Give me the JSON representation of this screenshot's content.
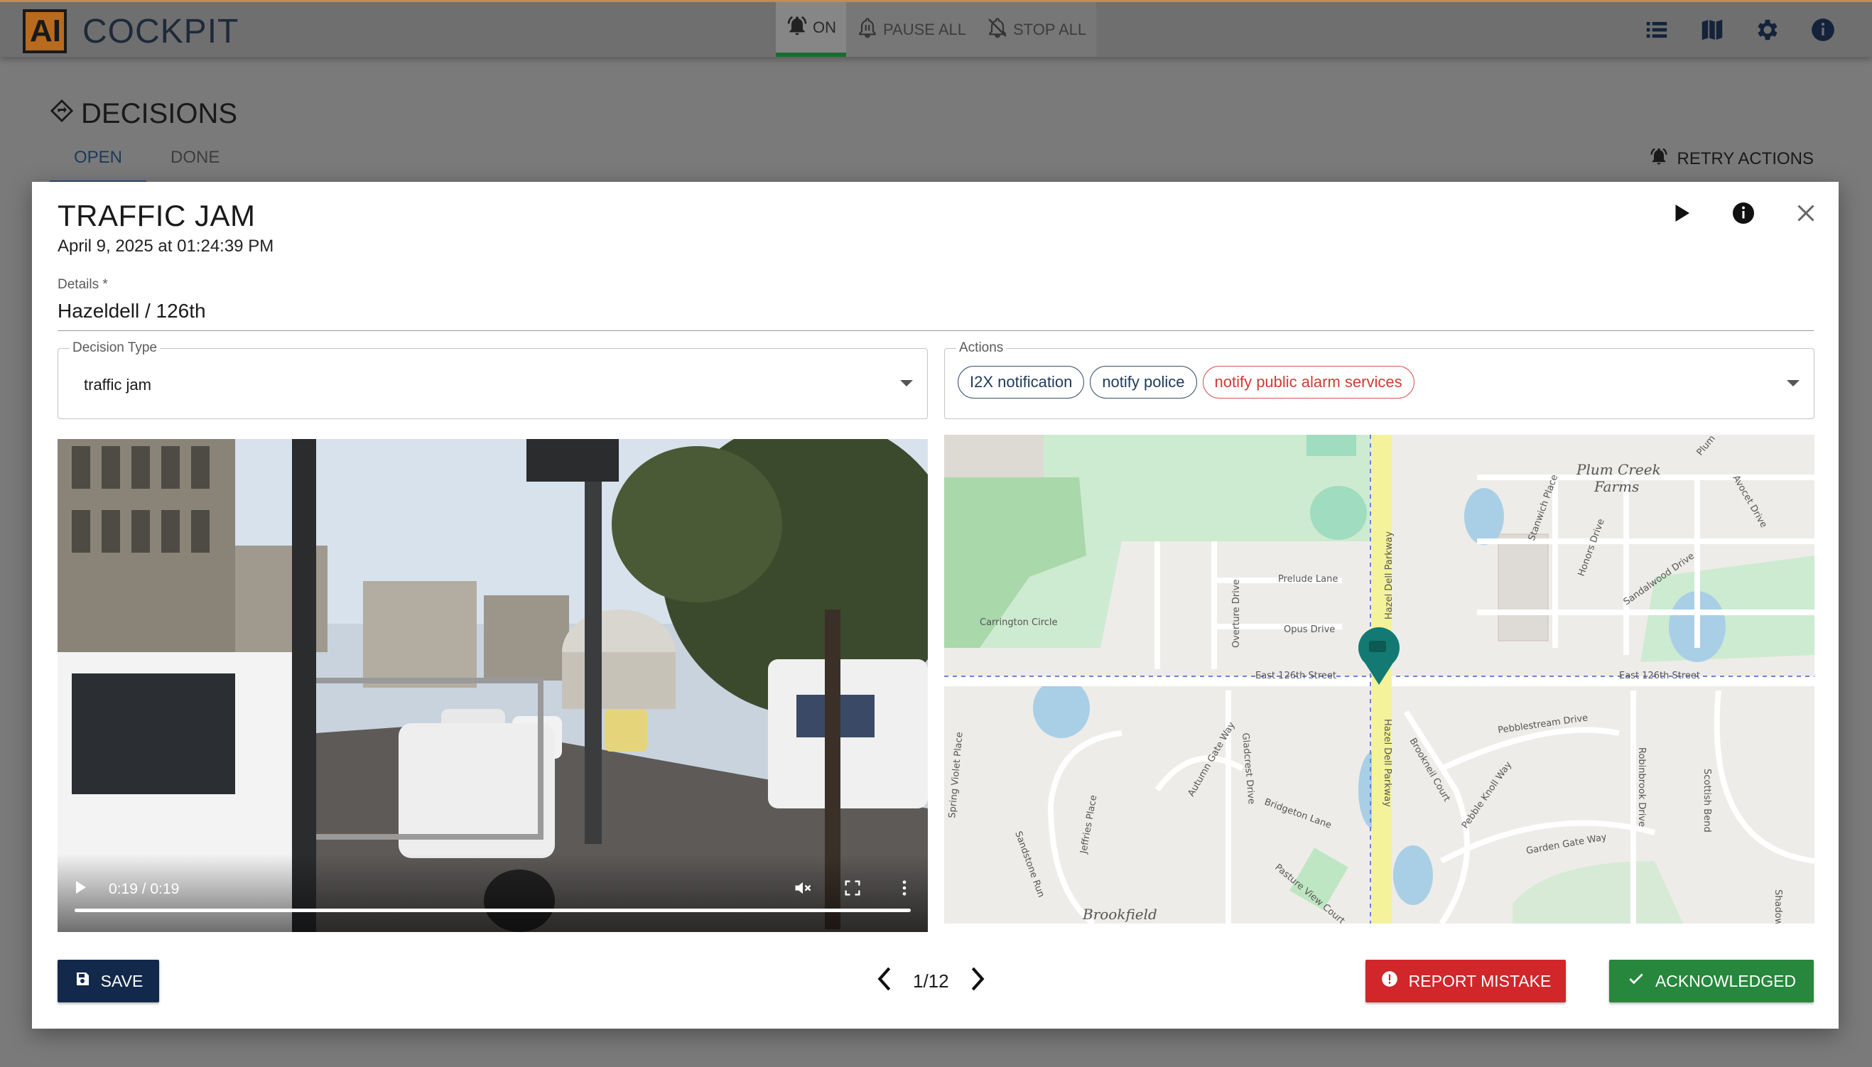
{
  "app": {
    "logo_text": "AI",
    "title": "COCKPIT"
  },
  "alarm_controls": {
    "on_label": "ON",
    "pause_label": "PAUSE ALL",
    "stop_label": "STOP ALL"
  },
  "header_icons": [
    "list-icon",
    "map-icon",
    "gear-icon",
    "info-icon"
  ],
  "page": {
    "title": "DECISIONS",
    "tabs": [
      {
        "label": "OPEN",
        "active": true
      },
      {
        "label": "DONE",
        "active": false
      }
    ],
    "retry_label": "RETRY ACTIONS"
  },
  "decision": {
    "title": "TRAFFIC JAM",
    "timestamp": "April 9, 2025 at 01:24:39 PM",
    "details_label": "Details *",
    "details_value": "Hazeldell / 126th",
    "decision_type_label": "Decision Type",
    "decision_type_value": "traffic jam",
    "actions_label": "Actions",
    "actions": [
      {
        "label": "I2X notification",
        "color": "#34506e"
      },
      {
        "label": "notify police",
        "color": "#34506e"
      },
      {
        "label": "notify public alarm services",
        "color": "#d9534f"
      }
    ]
  },
  "video": {
    "time": "0:19 / 0:19",
    "progress": 1.0,
    "muted": true
  },
  "map": {
    "streets": [
      "East 126th Street",
      "East 126th Street",
      "Hazel Dell Parkway",
      "Hazel Dell Parkway",
      "Prelude Lane",
      "Opus Drive",
      "Overture Drive",
      "Carrington Circle",
      "Pebblestream Drive",
      "Brookneil Court",
      "Pebble Knoll Way",
      "Garden Gate Way",
      "Autumn Gate Way",
      "Gladcrest Drive",
      "Bridgeton Lane",
      "Jeffries Place",
      "Sandstone Run",
      "Spring Violet Place",
      "Pasture View Court",
      "Robinbrook Drive",
      "Scottish Bend",
      "Shadow C",
      "Sandalwood Drive",
      "Honors Drive",
      "Stanwich Place",
      "Avocet Drive",
      "Plum Cre"
    ],
    "places": [
      "Plum Creek",
      "Farms",
      "Brookfield"
    ]
  },
  "footer": {
    "save_label": "SAVE",
    "pager": "1/12",
    "report_label": "REPORT MISTAKE",
    "ack_label": "ACKNOWLEDGED"
  },
  "colors": {
    "save": "#13294b",
    "report": "#d1262a",
    "acknowledged": "#27873d",
    "marker": "#127a72"
  }
}
